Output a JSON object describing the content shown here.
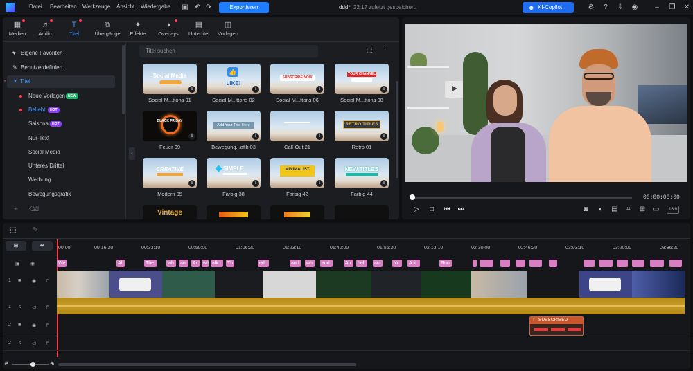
{
  "menu": [
    "Datei",
    "Bearbeiten",
    "Werkzeuge",
    "Ansicht",
    "Wiedergabe"
  ],
  "project": {
    "title": "ddd*",
    "status": "22:17 zuletzt gespeichert."
  },
  "export_label": "Exportieren",
  "ai_copilot_label": "KI-Copilot",
  "categories": [
    {
      "label": "Medien",
      "icon": "media-icon",
      "dot": true
    },
    {
      "label": "Audio",
      "icon": "music-note-icon",
      "dot": true
    },
    {
      "label": "Titel",
      "icon": "title-t-icon",
      "dot": true
    },
    {
      "label": "Übergänge",
      "icon": "transition-icon",
      "dot": false
    },
    {
      "label": "Effekte",
      "icon": "effects-icon",
      "dot": false
    },
    {
      "label": "Overlays",
      "icon": "overlays-icon",
      "dot": true
    },
    {
      "label": "Untertitel",
      "icon": "subtitle-icon",
      "dot": false
    },
    {
      "label": "Vorlagen",
      "icon": "templates-icon",
      "dot": false
    }
  ],
  "sidebar": {
    "favorites": "Eigene Favoriten",
    "custom": "Benutzerdefiniert",
    "titles": "Titel",
    "items": [
      {
        "label": "Neue Vorlagen",
        "badge": "NEW"
      },
      {
        "label": "Beliebt",
        "badge": "HOT"
      },
      {
        "label": "Saisonal",
        "badge": "HOT"
      },
      {
        "label": "Nur-Text",
        "badge": ""
      },
      {
        "label": "Social Media",
        "badge": ""
      },
      {
        "label": "Unteres Drittel",
        "badge": ""
      },
      {
        "label": "Werbung",
        "badge": ""
      },
      {
        "label": "Bewegungsgrafik",
        "badge": ""
      }
    ]
  },
  "search": {
    "placeholder": "Titel suchen"
  },
  "tiles": [
    {
      "label": "Social M...ttons 01",
      "text": "Social Media"
    },
    {
      "label": "Social M...ttons 02",
      "text": "LIKE!"
    },
    {
      "label": "Social M...ttons 06",
      "text": "SUBSCRIBE NOW"
    },
    {
      "label": "Social M...ttons 08",
      "text": "YOUR CHANNEL"
    },
    {
      "label": "Feuer 09",
      "text": "BLACK FRIDAY"
    },
    {
      "label": "Bewegung...afik 03",
      "text": "Add Your Title Here"
    },
    {
      "label": "Call-Out 21",
      "text": ""
    },
    {
      "label": "Retro 01",
      "text": "RETRO TITLES"
    },
    {
      "label": "Modern 05",
      "text": "CREATIVE"
    },
    {
      "label": "Farbig 38",
      "text": "SIMPLE"
    },
    {
      "label": "Farbig 42",
      "text": "MINIMALIST"
    },
    {
      "label": "Farbig 44",
      "text": "NEW TITLES"
    },
    {
      "label": "",
      "text": "Vintage"
    },
    {
      "label": "",
      "text": ""
    },
    {
      "label": "",
      "text": ""
    },
    {
      "label": "",
      "text": ""
    }
  ],
  "player": {
    "timecode": "00:00:00:00",
    "ratio": "16:9"
  },
  "ruler": [
    "00:00",
    "00:16:20",
    "00:33:10",
    "00:50:00",
    "01:06:20",
    "01:23:10",
    "01:40:00",
    "01:56:20",
    "02:13:10",
    "02:30:00",
    "02:46:20",
    "03:03:10",
    "03:20:00",
    "03:36:20"
  ],
  "title_tags": [
    "We",
    "Al",
    "The",
    "wh",
    "an",
    "Ar",
    "wh",
    "alk",
    "Th",
    "edi",
    "and",
    "wh",
    "and",
    "Au",
    "hel",
    "aui",
    "Yc",
    "A fi",
    "Runi"
  ],
  "track_labels": [
    "1",
    "1",
    "2",
    "2"
  ],
  "subscribed_clip": "SUBSCRIBED"
}
